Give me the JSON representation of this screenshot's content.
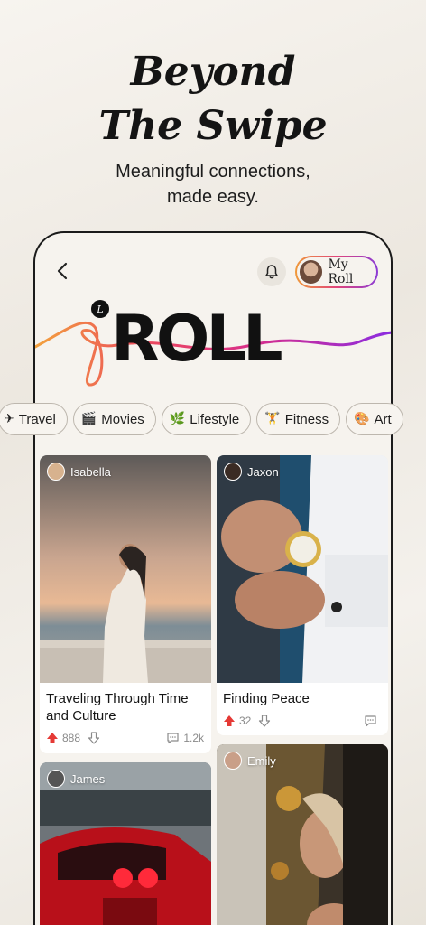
{
  "promo": {
    "headline_line1": "Beyond",
    "headline_line2": "The Swipe",
    "tagline_line1": "Meaningful connections,",
    "tagline_line2": "made easy."
  },
  "header": {
    "my_roll_label": "My Roll"
  },
  "logo": {
    "text": "ROLL",
    "badge": "L"
  },
  "categories": [
    {
      "icon": "airplane-icon",
      "glyph": "✈",
      "label": "Travel"
    },
    {
      "icon": "clapperboard-icon",
      "glyph": "🎬",
      "label": "Movies"
    },
    {
      "icon": "leaf-icon",
      "glyph": "🌿",
      "label": "Lifestyle"
    },
    {
      "icon": "weightlifter-icon",
      "glyph": "🏋",
      "label": "Fitness"
    },
    {
      "icon": "palette-icon",
      "glyph": "🎨",
      "label": "Art"
    }
  ],
  "posts": [
    {
      "user": "Isabella",
      "title_line1": "Traveling Through Time",
      "title_line2": "and Culture",
      "upvotes": "888",
      "comments": "1.2k"
    },
    {
      "user": "Jaxon",
      "title_line1": "Finding Peace",
      "title_line2": "",
      "upvotes": "32",
      "comments": ""
    },
    {
      "user": "James"
    },
    {
      "user": "Emily"
    }
  ],
  "colors": {
    "accent_gradient": [
      "#f09a3a",
      "#e0447a",
      "#8b3bd6"
    ],
    "upvote": "#e53935"
  }
}
